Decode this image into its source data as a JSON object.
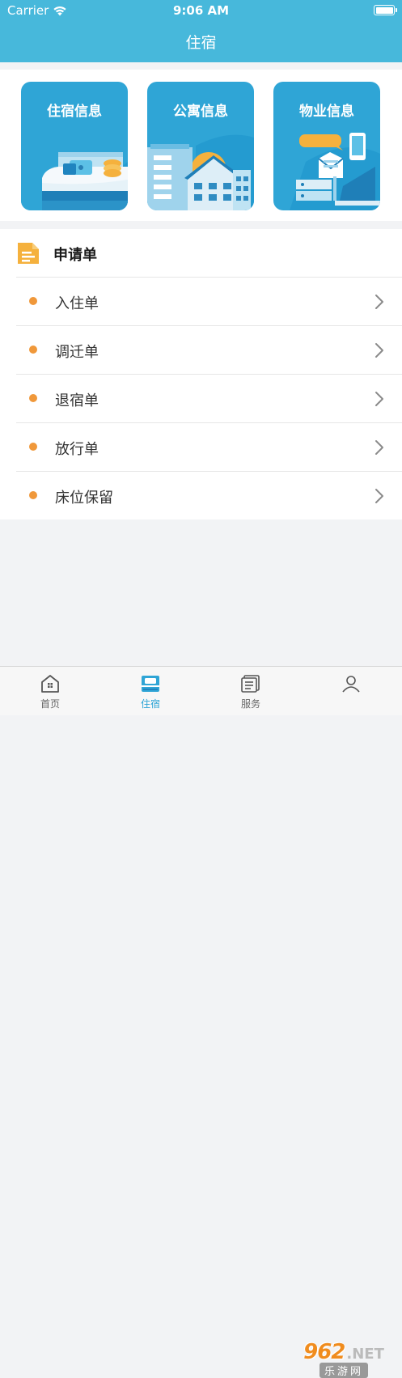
{
  "status_bar": {
    "carrier": "Carrier",
    "time": "9:06 AM"
  },
  "header": {
    "title": "住宿"
  },
  "cards": [
    {
      "label": "住宿信息",
      "icon": "bed-icon"
    },
    {
      "label": "公寓信息",
      "icon": "apartment-icon"
    },
    {
      "label": "物业信息",
      "icon": "property-icon"
    }
  ],
  "applications": {
    "title": "申请单",
    "items": [
      {
        "label": "入住单"
      },
      {
        "label": "调迁单"
      },
      {
        "label": "退宿单"
      },
      {
        "label": "放行单"
      },
      {
        "label": "床位保留"
      }
    ]
  },
  "tab_bar": {
    "tabs": [
      {
        "label": "首页",
        "icon": "home-icon"
      },
      {
        "label": "住宿",
        "icon": "bed-icon",
        "active": true
      },
      {
        "label": "服务",
        "icon": "service-icon"
      },
      {
        "label": "",
        "icon": "profile-icon"
      }
    ]
  },
  "watermark": {
    "number": "962",
    "domain": ".NET",
    "sub": "乐游网"
  },
  "colors": {
    "primary": "#47b8db",
    "card": "#2fa5d6",
    "bullet": "#f0983a",
    "accent": "#f5b13d"
  }
}
